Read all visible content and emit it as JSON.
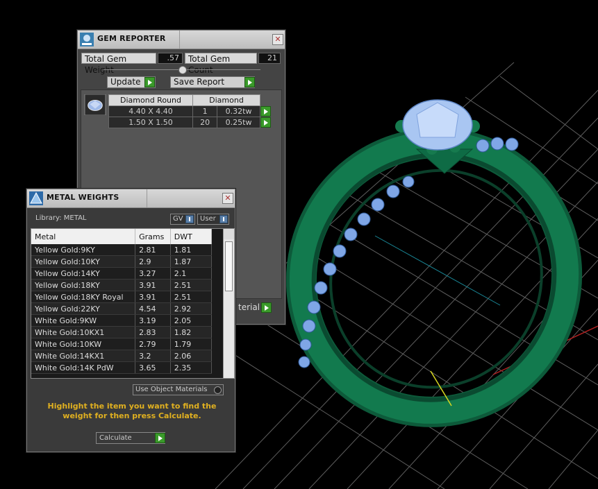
{
  "gem_reporter": {
    "title": "GEM REPORTER",
    "close": "✕",
    "total_weight_label": "Total Gem Weight",
    "total_weight_value": ".57",
    "total_count_label": "Total Gem Count",
    "total_count_value": "21",
    "update_label": "Update",
    "save_report_label": "Save Report",
    "table_headers": [
      "Diamond Round",
      "Diamond"
    ],
    "rows": [
      {
        "size": "4.40 X 4.40",
        "count": "1",
        "weight": "0.32tw"
      },
      {
        "size": "1.50 X 1.50",
        "count": "20",
        "weight": "0.25tw"
      }
    ],
    "material_button_label": "terial"
  },
  "metal_weights": {
    "title": "METAL WEIGHTS",
    "close": "✕",
    "library_label": "Library: METAL",
    "gv_label": "GV",
    "user_label": "User",
    "columns": [
      "Metal",
      "Grams",
      "DWT"
    ],
    "rows": [
      {
        "metal": "Yellow Gold:9KY",
        "grams": "2.81",
        "dwt": "1.81"
      },
      {
        "metal": "Yellow Gold:10KY",
        "grams": "2.9",
        "dwt": "1.87"
      },
      {
        "metal": "Yellow Gold:14KY",
        "grams": "3.27",
        "dwt": "2.1"
      },
      {
        "metal": "Yellow Gold:18KY",
        "grams": "3.91",
        "dwt": "2.51"
      },
      {
        "metal": "Yellow Gold:18KY Royal",
        "grams": "3.91",
        "dwt": "2.51"
      },
      {
        "metal": "Yellow Gold:22KY",
        "grams": "4.54",
        "dwt": "2.92"
      },
      {
        "metal": "White Gold:9KW",
        "grams": "3.19",
        "dwt": "2.05"
      },
      {
        "metal": "White Gold:10KX1",
        "grams": "2.83",
        "dwt": "1.82"
      },
      {
        "metal": "White Gold:10KW",
        "grams": "2.79",
        "dwt": "1.79"
      },
      {
        "metal": "White Gold:14KX1",
        "grams": "3.2",
        "dwt": "2.06"
      },
      {
        "metal": "White Gold:14K PdW",
        "grams": "3.65",
        "dwt": "2.35"
      }
    ],
    "use_object_materials_label": "Use Object Materials",
    "hint": "Highlight the item you want to find the weight for then press Calculate.",
    "calculate_label": "Calculate"
  },
  "colors": {
    "ring_green": "#0e6b45",
    "gem_blue": "#8fb6ea",
    "grid_line": "#6a6a6a",
    "hint_yellow": "#e0b020",
    "go_green": "#3a9a2a"
  }
}
